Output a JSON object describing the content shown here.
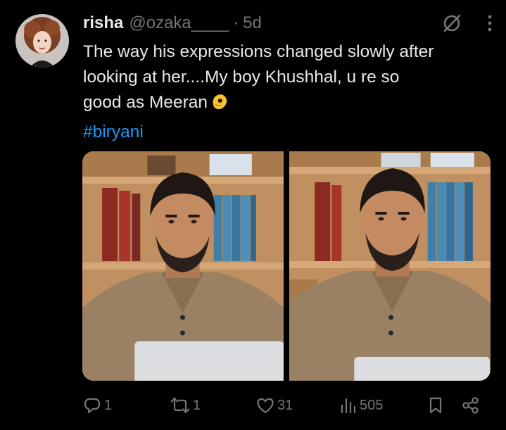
{
  "tweet": {
    "display_name": "risha",
    "handle": "@ozaka____",
    "separator": "·",
    "time": "5d",
    "text_lines": [
      "The way his expressions changed slowly after",
      "looking at her....My boy Khushhal, u re so",
      "good as Meeran"
    ],
    "emoji": "pinching-hand-emoji",
    "hashtag": "#biryani"
  },
  "header_icons": [
    "grok-icon",
    "more-options-icon"
  ],
  "media": {
    "count": 2,
    "images": [
      "photo-man-seated-bookshelf-left",
      "photo-man-seated-bookshelf-right"
    ]
  },
  "actions": {
    "replies": "1",
    "reposts": "1",
    "likes": "31",
    "views": "505",
    "icons": [
      "reply-icon",
      "repost-icon",
      "like-icon",
      "views-icon",
      "bookmark-icon",
      "share-icon"
    ]
  },
  "colors": {
    "background": "#000000",
    "text": "#e7e9ea",
    "muted": "#71767b",
    "accent": "#1d9bf0"
  }
}
